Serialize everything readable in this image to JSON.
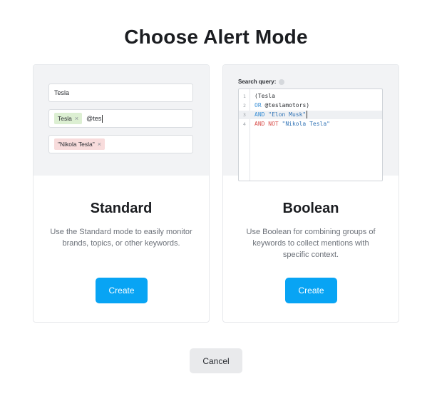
{
  "page": {
    "title": "Choose Alert Mode"
  },
  "standard": {
    "field1_text": "Tesla",
    "tag_keyword": "Tesla",
    "tag_x": "×",
    "typed_text": "@tes",
    "tag_excluded": "\"Nikola Tesla\"",
    "title": "Standard",
    "description": "Use the Standard mode to easily monitor brands, topics, or other keywords.",
    "create_label": "Create"
  },
  "boolean": {
    "query_label": "Search query:",
    "lines": [
      {
        "num": "1",
        "parts": [
          {
            "t": "(Tesla",
            "c": ""
          }
        ]
      },
      {
        "num": "2",
        "parts": [
          {
            "t": "OR",
            "c": "kw-blue"
          },
          {
            "t": " @teslamotors)",
            "c": ""
          }
        ]
      },
      {
        "num": "3",
        "parts": [
          {
            "t": "AND",
            "c": "kw-blue"
          },
          {
            "t": " \"Elon Musk\"",
            "c": "str"
          }
        ]
      },
      {
        "num": "4",
        "parts": [
          {
            "t": "AND NOT",
            "c": "kw-red"
          },
          {
            "t": " \"Nikola Tesla\"",
            "c": "str"
          }
        ]
      }
    ],
    "title": "Boolean",
    "description": "Use Boolean for combining groups of keywords to collect mentions with specific context.",
    "create_label": "Create"
  },
  "footer": {
    "cancel_label": "Cancel"
  },
  "colors": {
    "primary": "#08a4f4",
    "cancel_bg": "#e9eaec",
    "tag_green": "#dcefd2",
    "tag_red": "#f8dcdc"
  }
}
